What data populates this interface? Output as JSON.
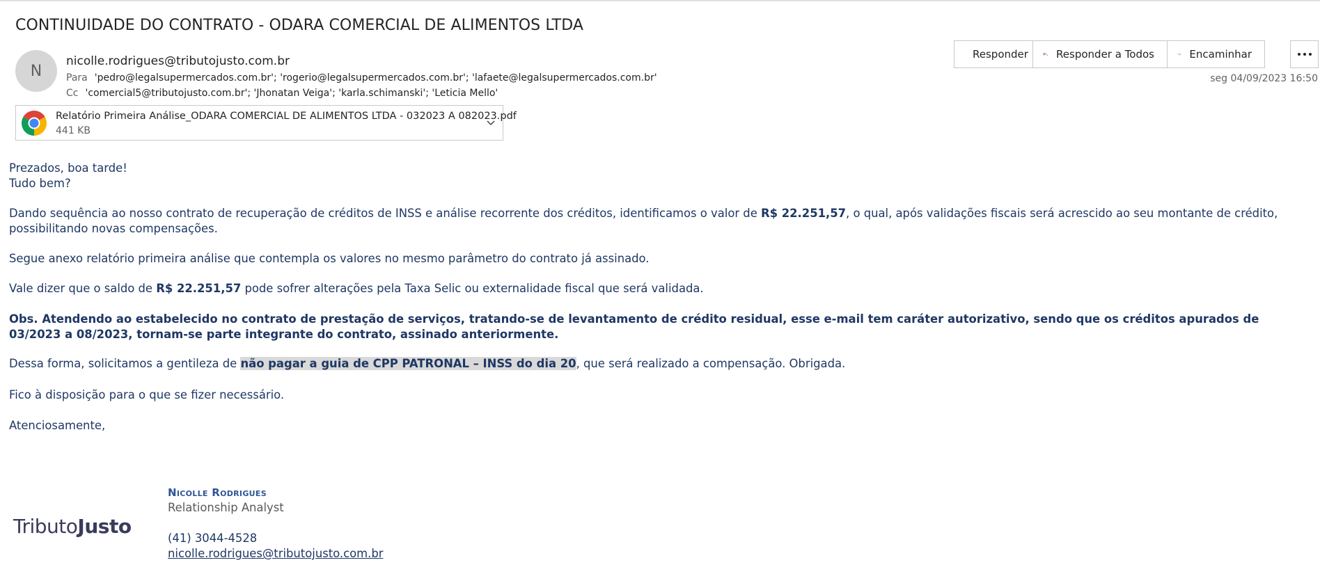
{
  "email": {
    "subject": "CONTINUIDADE DO CONTRATO - ODARA COMERCIAL DE ALIMENTOS LTDA",
    "avatar_initial": "N",
    "sender": "nicolle.rodrigues@tributojusto.com.br",
    "to_label": "Para",
    "to_value": "'pedro@legalsupermercados.com.br'; 'rogerio@legalsupermercados.com.br'; 'lafaete@legalsupermercados.com.br'",
    "cc_label": "Cc",
    "cc_value": "'comercial5@tributojusto.com.br'; 'Jhonatan Veiga'; 'karla.schimanski'; 'Leticia Mello'",
    "date": "seg 04/09/2023 16:50"
  },
  "actions": {
    "reply": "Responder",
    "reply_all": "Responder a Todos",
    "forward": "Encaminhar"
  },
  "attachment": {
    "icon": "chrome-icon",
    "filename": "Relatório Primeira Análise_ODARA COMERCIAL DE ALIMENTOS LTDA - 032023 A 082023.pdf",
    "size": "441 KB"
  },
  "body": {
    "greeting": "Prezados, boa tarde!",
    "greeting2": "Tudo bem?",
    "p1_a": "Dando sequência ao nosso contrato de recuperação de créditos de INSS e análise recorrente dos créditos, identificamos o valor de ",
    "p1_amount": "R$ 22.251,57",
    "p1_b": ", o qual, após validações fiscais será acrescido ao seu montante de crédito, possibilitando novas compensações.",
    "p2": "Segue anexo relatório primeira análise que contempla os valores no mesmo parâmetro do contrato já assinado.",
    "p3_a": "Vale dizer que o saldo de ",
    "p3_amount": "R$ 22.251,57",
    "p3_b": " pode sofrer alterações pela Taxa Selic ou externalidade fiscal que será validada.",
    "p4": "Obs. Atendendo ao estabelecido no contrato de prestação de serviços, tratando-se de levantamento de crédito residual, esse e-mail tem caráter autorizativo, sendo que os créditos apurados de 03/2023 a 08/2023, tornam-se parte integrante do contrato, assinado anteriormente.",
    "p5_a": "Dessa forma, solicitamos a gentileza de ",
    "p5_highlight": "não pagar a guia de CPP PATRONAL – INSS do dia 20",
    "p5_b": ", que será realizado a compensação. Obrigada.",
    "p6": "Fico à disposição para o que se fizer necessário.",
    "closing": "Atenciosamente,"
  },
  "signature": {
    "name": "Nicolle Rodrigues",
    "role": "Relationship Analyst",
    "phone": "(41) 3044-4528",
    "email": "nicolle.rodrigues@tributojusto.com.br",
    "logo_part1": "Tributo",
    "logo_part2": "Justo"
  }
}
